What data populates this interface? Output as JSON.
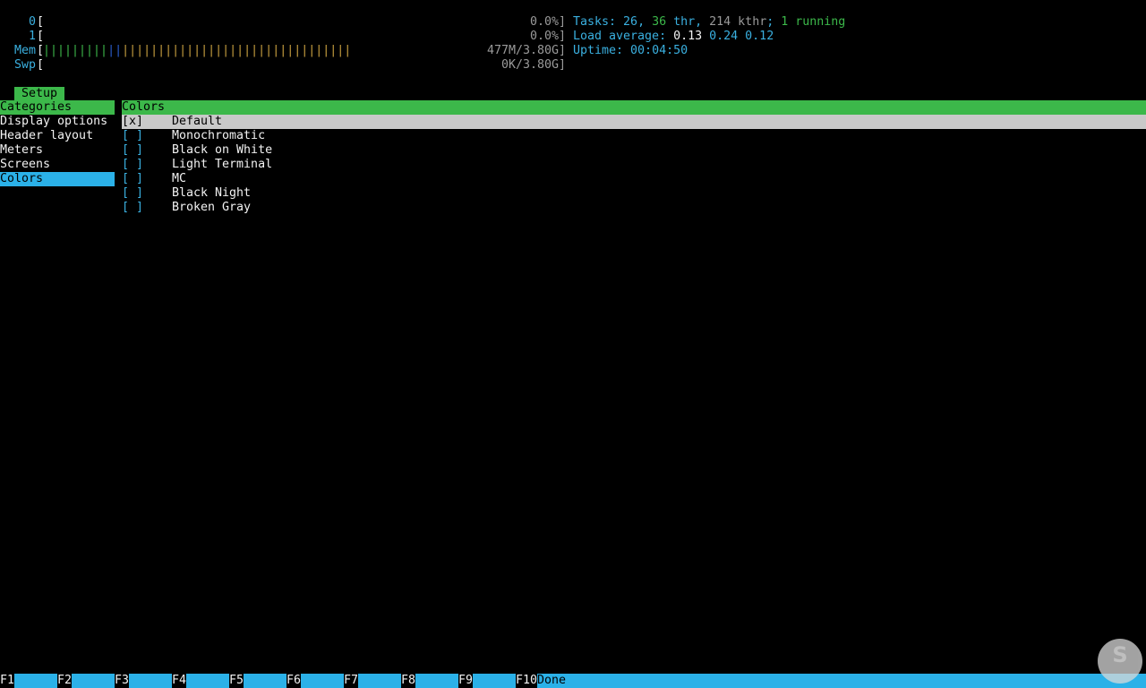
{
  "meters": [
    {
      "label": "0",
      "bar": "",
      "value": "0.0%]"
    },
    {
      "label": "1",
      "bar": "",
      "value": "0.0%]"
    },
    {
      "label": "Mem",
      "bar_green": "|||||||||",
      "bar_blue": "||",
      "bar_yellow": "||||||||||||||||||||||||||||||||",
      "value": "477M/3.80G]"
    },
    {
      "label": "Swp",
      "bar": "",
      "value": "0K/3.80G]"
    }
  ],
  "bracket_open": "[",
  "tasks": {
    "prefix": "Tasks: ",
    "tasks": "26",
    "sep1": ", ",
    "threads": "36",
    "thr": " thr",
    "sep2": ", ",
    "kthr_count": "214",
    "kthr": " kthr",
    "sep3": "; ",
    "running_count": "1",
    "running": " running"
  },
  "load": {
    "label": "Load average: ",
    "v1": "0.13",
    "v2": "0.24",
    "v3": "0.12"
  },
  "uptime": {
    "label": "Uptime: ",
    "value": "00:04:50"
  },
  "tab": "Setup",
  "categories": {
    "header": "Categories",
    "items": [
      "Display options",
      "Header layout",
      "Meters",
      "Screens",
      "Colors"
    ],
    "active_index": 4
  },
  "colors": {
    "header": "Colors",
    "items": [
      {
        "check": "[x]",
        "name": "Default",
        "selected": true
      },
      {
        "check": "[ ]",
        "name": "Monochromatic"
      },
      {
        "check": "[ ]",
        "name": "Black on White"
      },
      {
        "check": "[ ]",
        "name": "Light Terminal"
      },
      {
        "check": "[ ]",
        "name": "MC"
      },
      {
        "check": "[ ]",
        "name": "Black Night"
      },
      {
        "check": "[ ]",
        "name": "Broken Gray"
      }
    ]
  },
  "fkeys": [
    {
      "key": "F1",
      "label": ""
    },
    {
      "key": "F2",
      "label": ""
    },
    {
      "key": "F3",
      "label": ""
    },
    {
      "key": "F4",
      "label": ""
    },
    {
      "key": "F5",
      "label": ""
    },
    {
      "key": "F6",
      "label": ""
    },
    {
      "key": "F7",
      "label": ""
    },
    {
      "key": "F8",
      "label": ""
    },
    {
      "key": "F9",
      "label": ""
    },
    {
      "key": "F10",
      "label": "Done"
    }
  ],
  "logo_text": "S"
}
